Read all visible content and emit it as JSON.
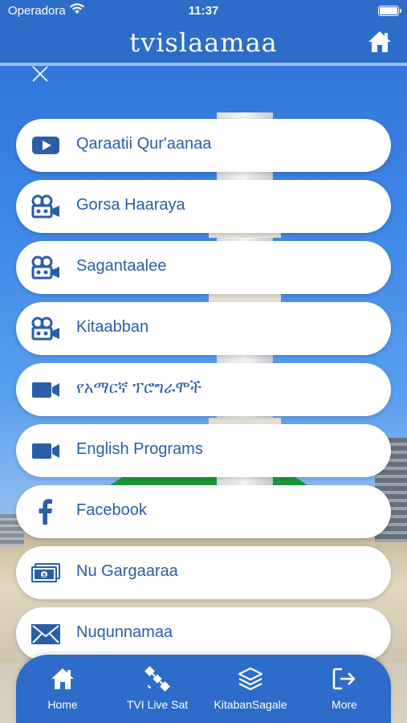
{
  "status_bar": {
    "carrier": "Operadora",
    "time": "11:37"
  },
  "header": {
    "title": "tvislaamaa"
  },
  "menu": [
    {
      "label": "Qaraatii Qur'aanaa",
      "icon": "youtube-play-icon"
    },
    {
      "label": "Gorsa Haaraya",
      "icon": "film-camera-icon"
    },
    {
      "label": "Sagantaalee",
      "icon": "film-camera-icon"
    },
    {
      "label": "Kitaabban",
      "icon": "film-camera-icon"
    },
    {
      "label": "የአማርኛ ፕሮግራሞች",
      "icon": "video-camera-icon"
    },
    {
      "label": " English Programs",
      "icon": "video-camera-icon"
    },
    {
      "label": "Facebook",
      "icon": "facebook-icon"
    },
    {
      "label": "Nu Gargaaraa",
      "icon": "money-icon"
    },
    {
      "label": "Nuqunnamaa",
      "icon": "envelope-icon"
    }
  ],
  "tabbar": [
    {
      "label": "Home",
      "icon": "home-icon"
    },
    {
      "label": "TVI Live Sat",
      "icon": "satellite-icon"
    },
    {
      "label": "KitabanSagale",
      "icon": "layers-icon"
    },
    {
      "label": "More",
      "icon": "sign-out-icon"
    }
  ],
  "colors": {
    "primary": "#2d6cc8",
    "label": "#2a5ea8",
    "background": "#ffffff"
  }
}
